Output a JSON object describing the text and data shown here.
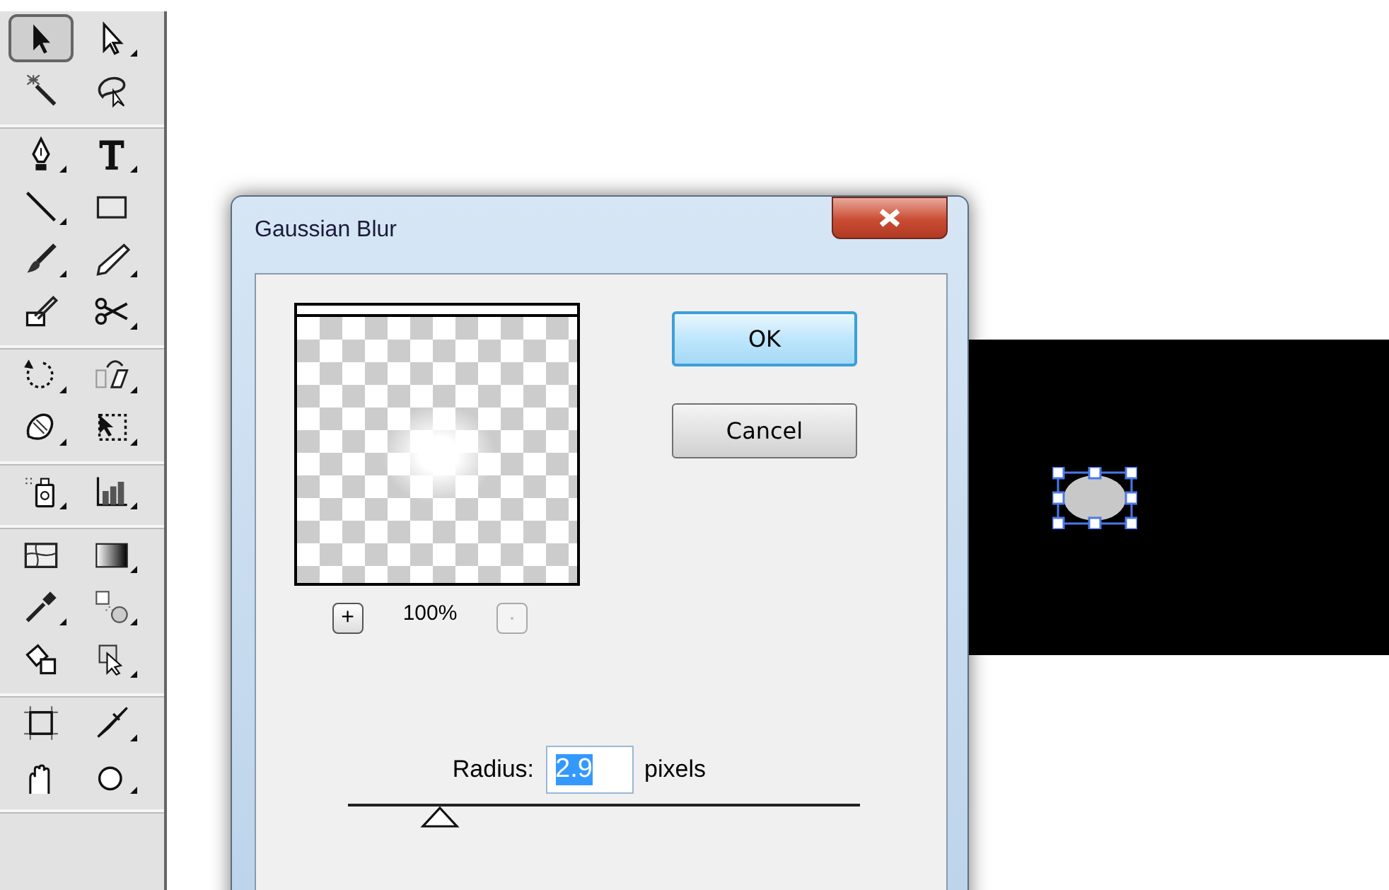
{
  "toolbox": {
    "groups": [
      {
        "tools": [
          {
            "selected": true
          },
          {
            "selected": false
          },
          {
            "selected": false
          },
          {
            "selected": false
          }
        ]
      },
      {
        "tools": [
          {
            "selected": false
          },
          {
            "selected": false
          },
          {
            "selected": false
          },
          {
            "selected": false
          },
          {
            "selected": false
          },
          {
            "selected": false
          },
          {
            "selected": false
          },
          {
            "selected": false
          }
        ]
      },
      {
        "tools": [
          {
            "selected": false
          },
          {
            "selected": false
          },
          {
            "selected": false
          },
          {
            "selected": false
          }
        ]
      },
      {
        "tools": [
          {
            "selected": false
          },
          {
            "selected": false
          }
        ]
      },
      {
        "tools": [
          {
            "selected": false
          },
          {
            "selected": false
          },
          {
            "selected": false
          },
          {
            "selected": false
          },
          {
            "selected": false
          },
          {
            "selected": false
          }
        ]
      },
      {
        "tools": [
          {
            "selected": false
          },
          {
            "selected": false
          },
          {
            "selected": false
          },
          {
            "selected": false
          }
        ]
      }
    ]
  },
  "canvas": {
    "objects": [
      {
        "kind": "ellipse",
        "selected": true
      }
    ]
  },
  "dialog": {
    "title": "Gaussian Blur",
    "preview": {
      "zoom_in": {
        "label": "+",
        "disabled": false
      },
      "zoom": "100%",
      "zoom_out": {
        "disabled": true
      }
    },
    "buttons": [
      {
        "label": "OK",
        "default": true
      },
      {
        "label": "Cancel",
        "default": false
      }
    ],
    "radius": {
      "label": "Radius:",
      "value": "2.9",
      "unit": "pixels",
      "text_selected": true,
      "level": 0.18
    }
  }
}
